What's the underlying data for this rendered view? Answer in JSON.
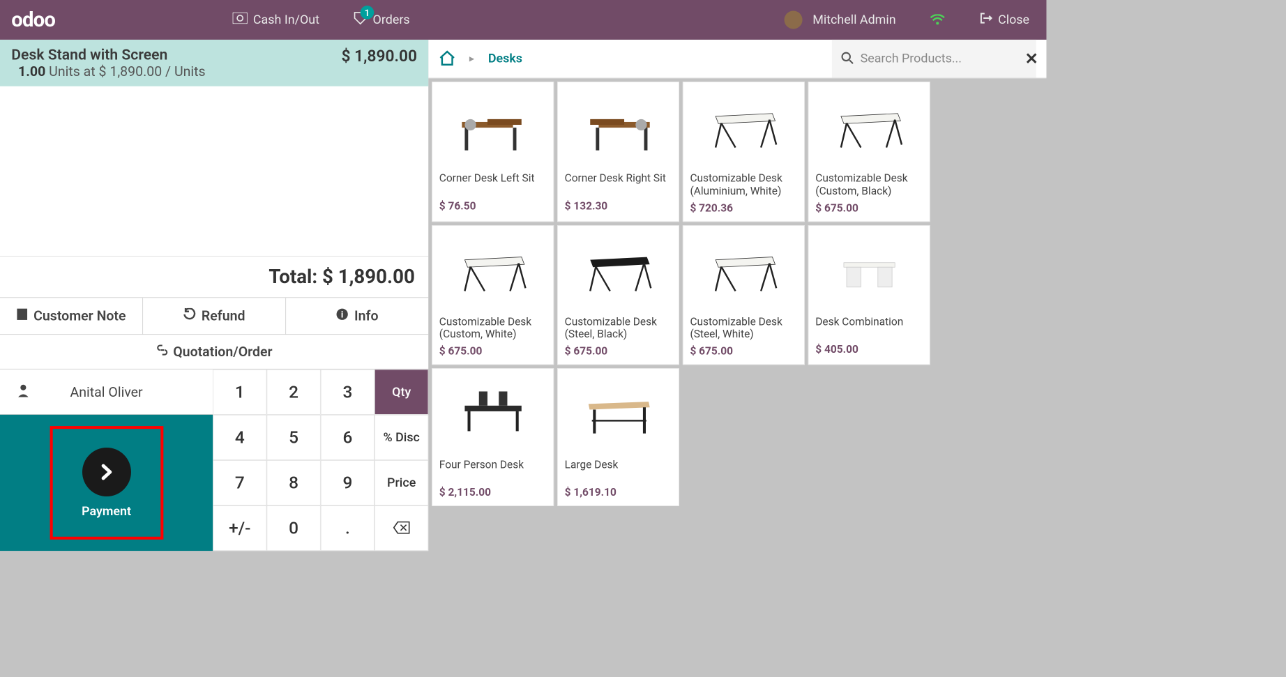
{
  "header": {
    "logo": "odoo",
    "cash_label": "Cash In/Out",
    "orders_label": "Orders",
    "orders_badge": "1",
    "user_name": "Mitchell Admin",
    "close_label": "Close"
  },
  "order": {
    "lines": [
      {
        "name": "Desk Stand with Screen",
        "qty": "1.00",
        "qty_text": "Units at $ 1,890.00 / Units",
        "price": "$ 1,890.00"
      }
    ],
    "total_label": "Total: $ 1,890.00"
  },
  "actions": {
    "customer_note": "Customer Note",
    "refund": "Refund",
    "info": "Info",
    "quotation": "Quotation/Order"
  },
  "customer": {
    "name": "Anital Oliver"
  },
  "payment": {
    "label": "Payment"
  },
  "numpad": {
    "k1": "1",
    "k2": "2",
    "k3": "3",
    "qty": "Qty",
    "k4": "4",
    "k5": "5",
    "k6": "6",
    "disc": "% Disc",
    "k7": "7",
    "k8": "8",
    "k9": "9",
    "price": "Price",
    "pm": "+/-",
    "k0": "0",
    "dot": ".",
    "bs": "⌫"
  },
  "breadcrumb": {
    "category": "Desks"
  },
  "search": {
    "placeholder": "Search Products..."
  },
  "products": [
    {
      "name": "Corner Desk Left Sit",
      "price": "$ 76.50",
      "img": "corner-left"
    },
    {
      "name": "Corner Desk Right Sit",
      "price": "$ 132.30",
      "img": "corner-right"
    },
    {
      "name": "Customizable Desk (Aluminium, White)",
      "price": "$ 720.36",
      "img": "trestle-white"
    },
    {
      "name": "Customizable Desk (Custom, Black)",
      "price": "$ 675.00",
      "img": "trestle-white"
    },
    {
      "name": "Customizable Desk (Custom, White)",
      "price": "$ 675.00",
      "img": "trestle-white"
    },
    {
      "name": "Customizable Desk (Steel, Black)",
      "price": "$ 675.00",
      "img": "trestle-black"
    },
    {
      "name": "Customizable Desk (Steel, White)",
      "price": "$ 675.00",
      "img": "trestle-white"
    },
    {
      "name": "Desk Combination",
      "price": "$ 405.00",
      "img": "combo"
    },
    {
      "name": "Four Person Desk",
      "price": "$ 2,115.00",
      "img": "quad"
    },
    {
      "name": "Large Desk",
      "price": "$ 1,619.10",
      "img": "large"
    }
  ]
}
